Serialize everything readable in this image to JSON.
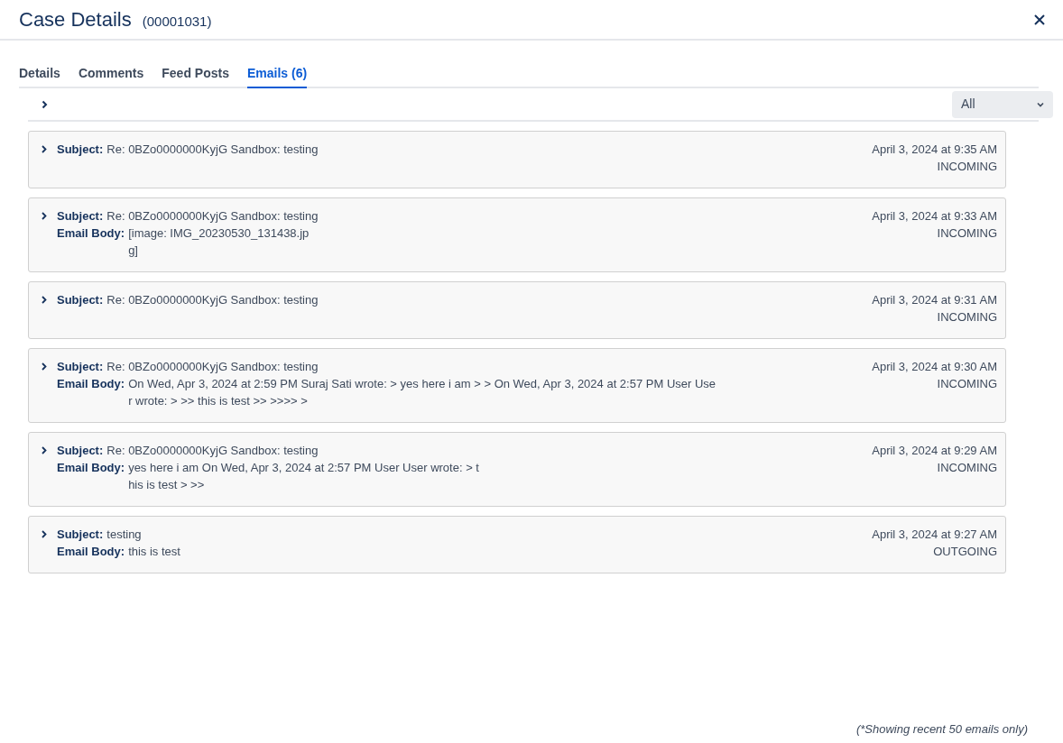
{
  "header": {
    "title": "Case Details",
    "case_number": "(00001031)"
  },
  "tabs": [
    {
      "label": "Details",
      "selected": false
    },
    {
      "label": "Comments",
      "selected": false
    },
    {
      "label": "Feed Posts",
      "selected": false
    },
    {
      "label": "Emails (6)",
      "selected": true
    }
  ],
  "filter": {
    "value": "All"
  },
  "emails": [
    {
      "subject_label": "Subject:",
      "subject": "Re: 0BZo0000000KyjG Sandbox: testing",
      "date": "April 3, 2024 at 9:35 AM",
      "direction": "INCOMING"
    },
    {
      "subject_label": "Subject:",
      "subject": "Re: 0BZo0000000KyjG Sandbox: testing",
      "body_label": "Email Body:",
      "body_lines": [
        "[image: IMG_20230530_131438.jp",
        "g]"
      ],
      "date": "April 3, 2024 at 9:33 AM",
      "direction": "INCOMING"
    },
    {
      "subject_label": "Subject:",
      "subject": "Re: 0BZo0000000KyjG Sandbox: testing",
      "date": "April 3, 2024 at 9:31 AM",
      "direction": "INCOMING"
    },
    {
      "subject_label": "Subject:",
      "subject": "Re: 0BZo0000000KyjG Sandbox: testing",
      "body_label": "Email Body:",
      "body_lines": [
        "On Wed, Apr 3, 2024 at 2:59 PM Suraj Sati wrote: > yes here i am > > On Wed, Apr 3, 2024 at 2:57 PM User Use",
        "r wrote: > >> this is test >> >>>> >"
      ],
      "date": "April 3, 2024 at 9:30 AM",
      "direction": "INCOMING"
    },
    {
      "subject_label": "Subject:",
      "subject": "Re: 0BZo0000000KyjG Sandbox: testing",
      "body_label": "Email Body:",
      "body_lines": [
        "yes here i am On Wed, Apr 3, 2024 at 2:57 PM User User wrote: > t",
        "his is test > >>"
      ],
      "date": "April 3, 2024 at 9:29 AM",
      "direction": "INCOMING"
    },
    {
      "subject_label": "Subject:",
      "subject": "testing",
      "body_label": "Email Body:",
      "body_lines": [
        "this is test"
      ],
      "date": "April 3, 2024 at 9:27 AM",
      "direction": "OUTGOING"
    }
  ],
  "footer_note": "(*Showing recent 50 emails only)"
}
